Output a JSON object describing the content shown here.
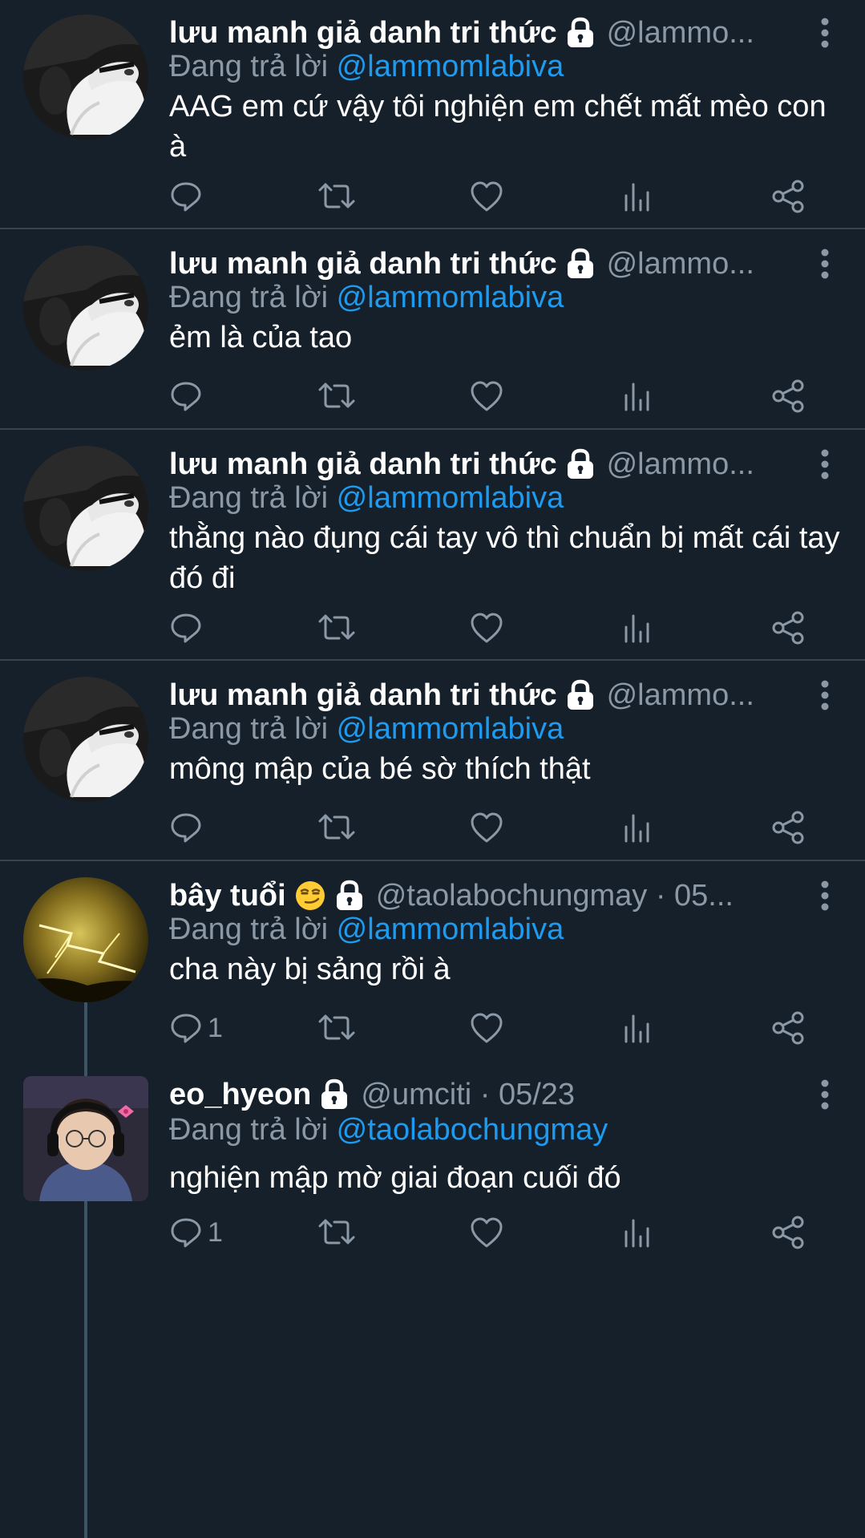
{
  "reply_prefix": "Đang trả lời",
  "tweets": [
    {
      "name": "lưu manh giả danh tri thức",
      "handle": "@lammo...",
      "reply_to": "@lammomlabiva",
      "text": "AAG  em cứ vậy tôi nghiện em chết mất mèo con à",
      "reply_count": "",
      "avatar": "cat-avatar",
      "has_emoji": false
    },
    {
      "name": "lưu manh giả danh tri thức",
      "handle": "@lammo...",
      "reply_to": "@lammomlabiva",
      "text": "ẻm là của tao",
      "reply_count": "",
      "avatar": "cat-avatar",
      "has_emoji": false
    },
    {
      "name": "lưu manh giả danh tri thức",
      "handle": "@lammo...",
      "reply_to": "@lammomlabiva",
      "text": "thằng nào đụng cái tay vô thì chuẩn bị mất cái tay đó đi",
      "reply_count": "",
      "avatar": "cat-avatar",
      "has_emoji": false
    },
    {
      "name": "lưu manh giả danh tri thức",
      "handle": "@lammo...",
      "reply_to": "@lammomlabiva",
      "text": "mông mập của bé sờ thích thật",
      "reply_count": "",
      "avatar": "cat-avatar",
      "has_emoji": false
    },
    {
      "name": "bây tuổi",
      "handle": "@taolabochungmay · 05...",
      "reply_to": "@lammomlabiva",
      "text": "cha này bị sảng rồi à",
      "reply_count": "1",
      "avatar": "lightning-avatar",
      "has_emoji": true
    },
    {
      "name": "eo_hyeon",
      "handle": "@umciti · 05/23",
      "reply_to": "@taolabochungmay",
      "text": "nghiện mập mờ giai đoạn cuối đó",
      "reply_count": "1",
      "avatar": "person-avatar",
      "has_emoji": false
    }
  ],
  "icons": {
    "reply": "reply-icon",
    "retweet": "retweet-icon",
    "like": "heart-icon",
    "views": "views-icon",
    "share": "share-icon",
    "more": "more-vertical-icon",
    "lock": "lock-icon",
    "emoji": "smirk-emoji-icon"
  },
  "colors": {
    "background": "#15202b",
    "text": "#ffffff",
    "secondary_text": "#8b98a5",
    "link": "#1d9bf0",
    "divider": "#38444d",
    "thread_line": "#3d5466"
  }
}
